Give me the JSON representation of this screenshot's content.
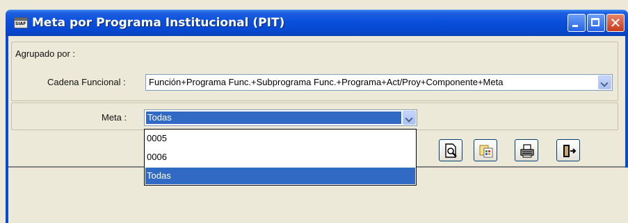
{
  "window": {
    "title": "Meta por Programa Institucional (PIT)",
    "app_icon_label": "SIAF",
    "controls": {
      "minimize": "minimize-icon",
      "maximize": "maximize-icon",
      "close": "close-icon",
      "close_glyph": "✕"
    }
  },
  "agrupado": {
    "label": "Agrupado por :",
    "cadena_label": "Cadena Funcional :",
    "cadena_value": "Función+Programa Func.+Subprograma Func.+Programa+Act/Proy+Componente+Meta"
  },
  "meta": {
    "label": "Meta :",
    "value": "Todas",
    "options": [
      "0005",
      "0006",
      "Todas"
    ],
    "selected_index": 2
  },
  "toolbar": {
    "buttons": [
      {
        "name": "preview-button",
        "icon": "preview-icon"
      },
      {
        "name": "export-button",
        "icon": "export-icon"
      },
      {
        "name": "print-button",
        "icon": "printer-icon"
      },
      {
        "name": "exit-button",
        "icon": "exit-door-icon"
      }
    ]
  },
  "colors": {
    "titlebar": "#0a4fdc",
    "selection": "#316ac5",
    "dialog_bg": "#ece9d8"
  }
}
